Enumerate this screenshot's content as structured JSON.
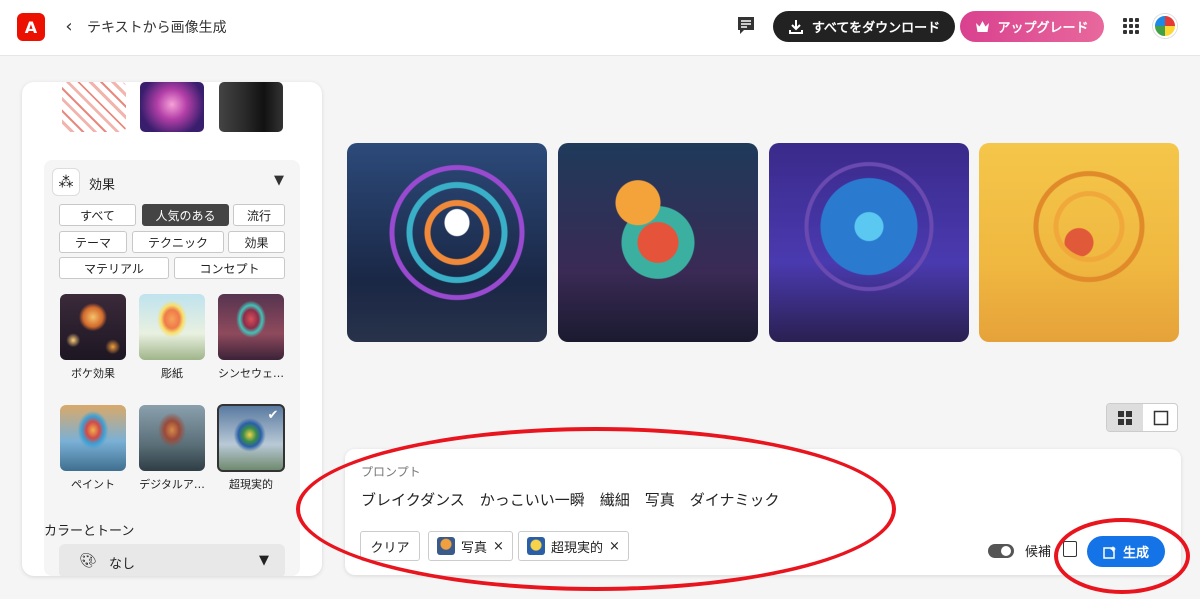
{
  "app": {
    "logo_glyph": "A",
    "title": "テキストから画像生成",
    "back_glyph": "‹"
  },
  "toolbar": {
    "download_label": "すべてをダウンロード",
    "upgrade_label": "アップグレード",
    "comment_icon": "comment-icon",
    "download_icon": "download-icon",
    "crown_icon": "crown-icon",
    "apps_icon": "apps-grid-icon"
  },
  "effects": {
    "title": "効果",
    "filters": [
      {
        "label": "すべて",
        "selected": false
      },
      {
        "label": "人気のある",
        "selected": true
      },
      {
        "label": "流行",
        "selected": false
      },
      {
        "label": "テーマ",
        "selected": false
      },
      {
        "label": "テクニック",
        "selected": false
      },
      {
        "label": "効果",
        "selected": false
      },
      {
        "label": "マテリアル",
        "selected": false
      },
      {
        "label": "コンセプト",
        "selected": false
      }
    ],
    "styles": [
      {
        "label": "ボケ効果",
        "selected": false
      },
      {
        "label": "彫紙",
        "selected": false
      },
      {
        "label": "シンセウェ…",
        "selected": false
      },
      {
        "label": "ペイント",
        "selected": false
      },
      {
        "label": "デジタルア…",
        "selected": false
      },
      {
        "label": "超現実的",
        "selected": true
      }
    ]
  },
  "color_tone": {
    "title": "カラーとトーン",
    "value": "なし"
  },
  "gallery": {
    "count": 4
  },
  "view_toggle": {
    "active": "grid"
  },
  "prompt": {
    "label": "プロンプト",
    "text": "ブレイクダンス　かっこいい一瞬　繊細　写真　ダイナミック",
    "clear_label": "クリア",
    "tags": [
      {
        "label": "写真"
      },
      {
        "label": "超現実的"
      }
    ],
    "tag_remove_glyph": "×",
    "candidates_label": "候補",
    "generate_label": "生成"
  },
  "colors": {
    "accent": "#1473e6",
    "brand": "#eb1000",
    "annotation": "#e8141e"
  }
}
